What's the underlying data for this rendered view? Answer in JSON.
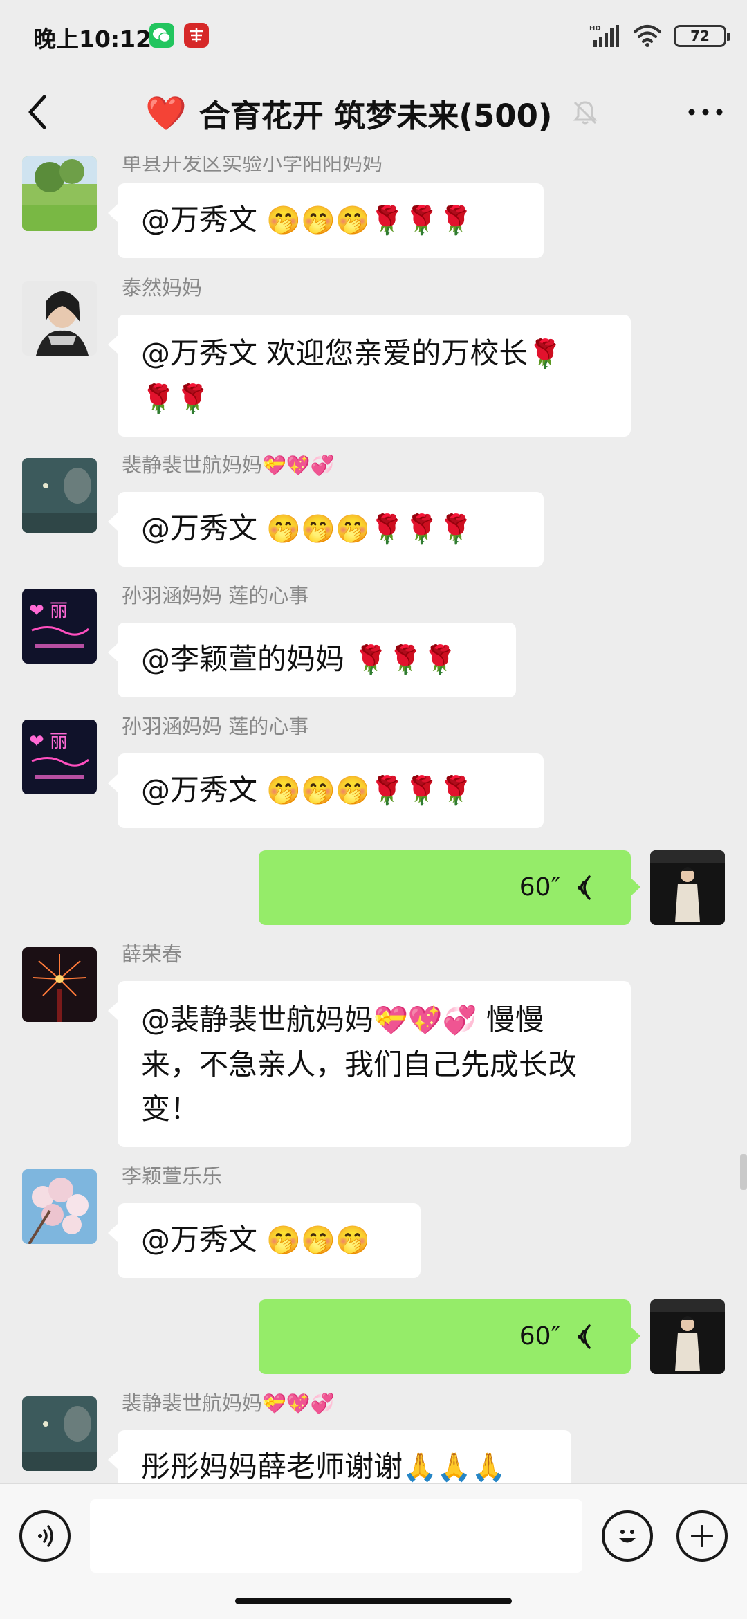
{
  "status_bar": {
    "time": "晚上10:12",
    "network": "HD",
    "battery": "72"
  },
  "header": {
    "back_label": "back",
    "title_icon": "❤️",
    "title": "合育花开 筑梦未来(500)",
    "muted_icon": "bell-off-icon",
    "more_icon": "more-icon"
  },
  "messages": [
    {
      "sender": "单县开发区实验小学阳阳妈妈",
      "text_line1": "@万秀文 ",
      "emoji_line1": "🤭🤭🤭🌹🌹🌹"
    },
    {
      "sender": "泰然妈妈",
      "text_line1": "@万秀文 欢迎您亲爱的万校长",
      "emoji_line1": "🌹",
      "emoji_line2": "🌹🌹"
    },
    {
      "sender": "裴静裴世航妈妈",
      "sender_emoji": "💝💖💞",
      "text_line1": "@万秀文 ",
      "emoji_line1": "🤭🤭🤭🌹🌹🌹"
    },
    {
      "sender": "孙羽涵妈妈  莲的心事",
      "text_line1": "@李颖萱的妈妈 ",
      "emoji_line1": "🌹🌹🌹"
    },
    {
      "sender": "孙羽涵妈妈  莲的心事",
      "text_line1": "@万秀文 ",
      "emoji_line1": "🤭🤭🤭🌹🌹🌹"
    },
    {
      "self": true,
      "voice_length": "60″"
    },
    {
      "sender": "薛荣春",
      "text_line1": "@裴静裴世航妈妈",
      "emoji_line1": "💝💖💞",
      "text_line1b": " 慢慢",
      "text_line2": "来，不急亲人，我们自己先成长改",
      "text_line3": "变！"
    },
    {
      "sender": "李颖萱乐乐",
      "text_line1": "@万秀文 ",
      "emoji_line1": "🤭🤭🤭"
    },
    {
      "self": true,
      "voice_length": "60″"
    },
    {
      "sender": "裴静裴世航妈妈",
      "sender_emoji": "💝💖💞",
      "text_line1": "彤彤妈妈薛老师谢谢",
      "emoji_line1": "🙏🙏🙏"
    }
  ],
  "input": {
    "value": "",
    "placeholder": ""
  }
}
